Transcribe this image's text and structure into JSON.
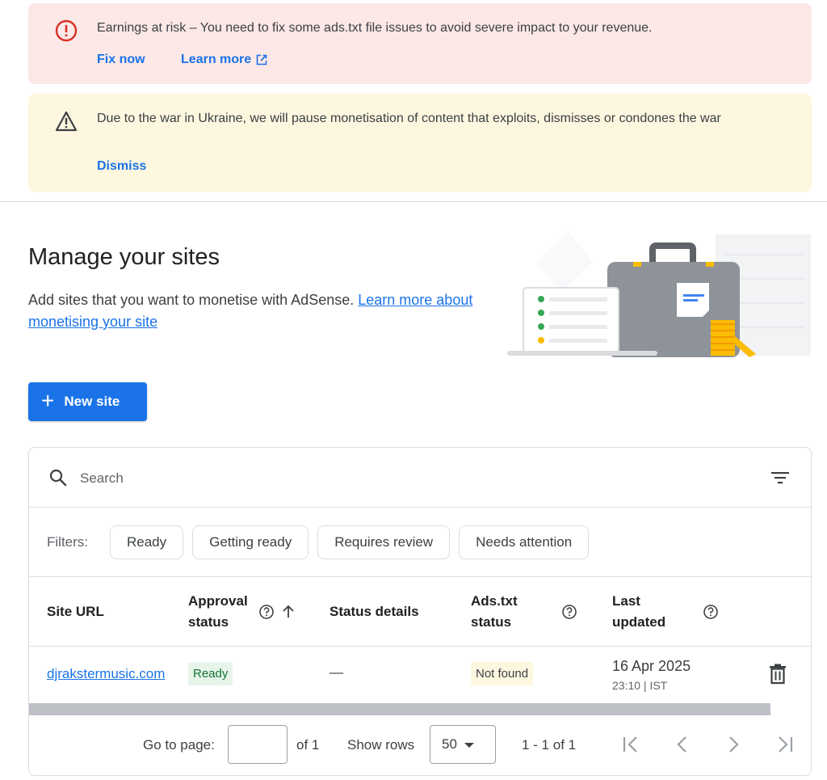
{
  "alerts": {
    "earnings": {
      "icon": "error-circle-icon",
      "message": "Earnings at risk – You need to fix some ads.txt file issues to avoid severe impact to your revenue.",
      "fix_label": "Fix now",
      "learn_label": "Learn more"
    },
    "ukraine": {
      "icon": "warning-triangle-icon",
      "message": "Due to the war in Ukraine, we will pause monetisation of content that exploits, dismisses or condones the war",
      "dismiss_label": "Dismiss"
    }
  },
  "page": {
    "title": "Manage your sites",
    "description": "Add sites that you want to monetise with AdSense.",
    "learn_link": "Learn more about monetising your site"
  },
  "toolbar": {
    "new_site_label": "New site"
  },
  "search": {
    "placeholder": "Search"
  },
  "filters": {
    "label": "Filters:",
    "chips": [
      "Ready",
      "Getting ready",
      "Requires review",
      "Needs attention"
    ]
  },
  "table": {
    "columns": {
      "site_url": "Site URL",
      "approval_1": "Approval",
      "approval_2": "status",
      "status_details": "Status details",
      "ads_txt_1": "Ads.txt",
      "ads_txt_2": "status",
      "updated_1": "Last",
      "updated_2": "updated"
    },
    "rows": [
      {
        "site_url": "djrakstermusic.com",
        "approval_status": "Ready",
        "status_details": "—",
        "ads_txt_status": "Not found",
        "last_updated_date": "16 Apr 2025",
        "last_updated_time": "23:10 | IST"
      }
    ]
  },
  "pagination": {
    "go_to_label": "Go to page:",
    "page_value": "",
    "of_label": "of 1",
    "show_rows_label": "Show rows",
    "rows_value": "50",
    "range_label": "1 - 1 of 1"
  },
  "colors": {
    "primary": "#1a73e8",
    "error_bg": "#fce8e6",
    "warn_bg": "#fef7e0",
    "ready_bg": "#e6f4ea",
    "ready_fg": "#137333",
    "error_icon": "#d93025"
  }
}
